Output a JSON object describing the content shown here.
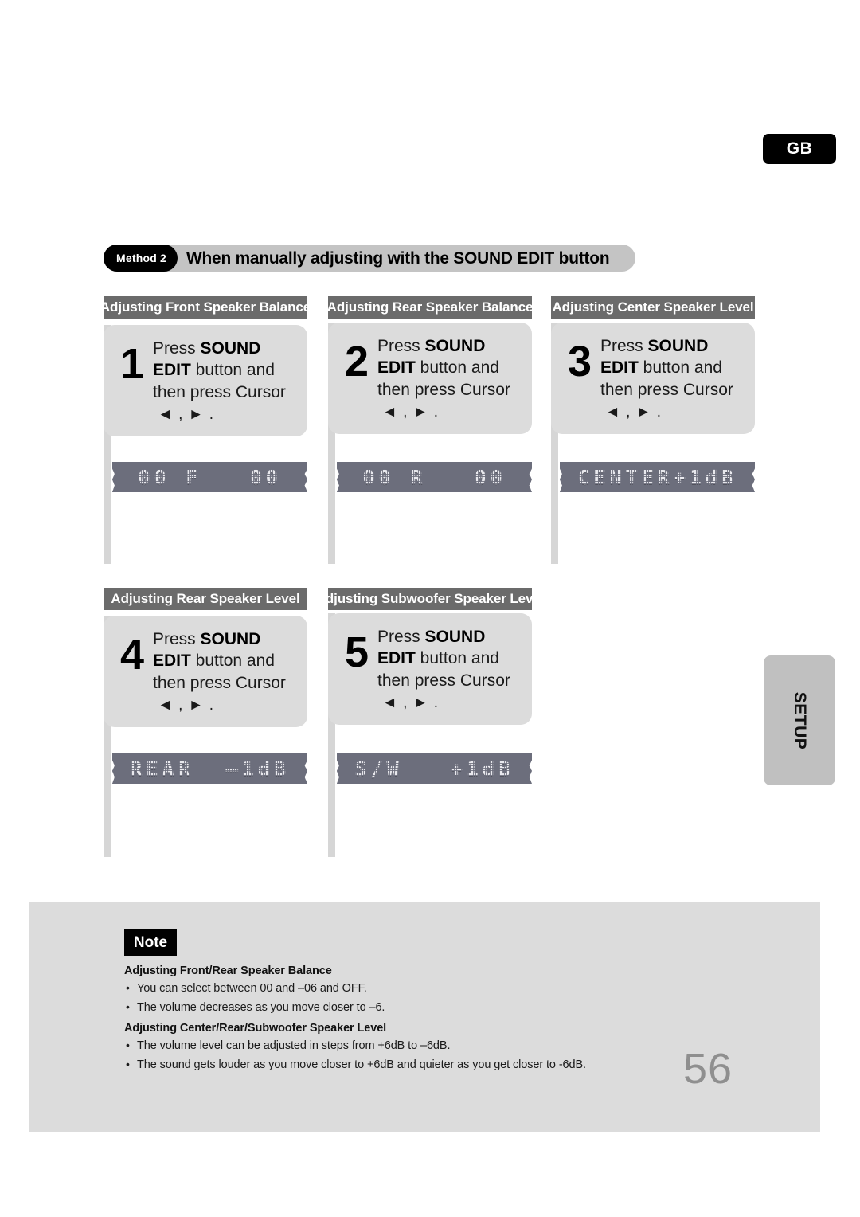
{
  "language_tab": {
    "label": "GB"
  },
  "side_tab": {
    "label": "SETUP"
  },
  "method_banner": {
    "badge": "Method 2",
    "title": "When manually adjusting with the SOUND EDIT button"
  },
  "steps": [
    {
      "header": "Adjusting Front Speaker Balance",
      "number": "1",
      "line1_pre": "Press ",
      "line1_bold": "SOUND",
      "line2_bold": "EDIT",
      "line2_post": " button and",
      "line3": "then press Cursor",
      "cursor": "◄ , ► .",
      "display": "00 F   00"
    },
    {
      "header": "Adjusting Rear Speaker Balance",
      "number": "2",
      "line1_pre": "Press ",
      "line1_bold": "SOUND",
      "line2_bold": "EDIT",
      "line2_post": " button and",
      "line3": "then press Cursor",
      "cursor": "◄ , ► .",
      "display": "00 R   00"
    },
    {
      "header": "Adjusting Center Speaker Level",
      "number": "3",
      "line1_pre": "Press ",
      "line1_bold": "SOUND",
      "line2_bold": "EDIT",
      "line2_post": " button and",
      "line3": "then press Cursor",
      "cursor": "◄ , ► .",
      "display": "CENTER+1dB"
    },
    {
      "header": "Adjusting Rear Speaker Level",
      "number": "4",
      "line1_pre": "Press ",
      "line1_bold": "SOUND",
      "line2_bold": "EDIT",
      "line2_post": " button and",
      "line3": "then press Cursor",
      "cursor": "◄ , ► .",
      "display": "REAR  –1dB"
    },
    {
      "header": "Adjusting Subwoofer Speaker Level",
      "number": "5",
      "line1_pre": "Press ",
      "line1_bold": "SOUND",
      "line2_bold": "EDIT",
      "line2_post": " button and",
      "line3": "then press Cursor",
      "cursor": "◄ , ► .",
      "display": "S/W   +1dB"
    }
  ],
  "note": {
    "badge": "Note",
    "section1_heading": "Adjusting Front/Rear Speaker Balance",
    "section1_bullets": [
      "You can select between 00 and –06 and OFF.",
      "The volume decreases as you move closer to –6."
    ],
    "section2_heading": "Adjusting Center/Rear/Subwoofer Speaker Level",
    "section2_bullets": [
      "The volume level can be adjusted in steps from +6dB to –6dB.",
      "The sound gets louder as you move closer to +6dB and quieter as you get closer to -6dB."
    ]
  },
  "page_number": "56",
  "colors": {
    "header_bar": "#6b6b6b",
    "step_box": "#dcdcdc",
    "lcd_bg": "#6c6e7c",
    "lcd_text": "#e9e9ee",
    "spine": "#d6d6d6",
    "note_bg": "#dcdcdc",
    "badge_black": "#000000",
    "page_number": "#8f8f8f",
    "setup_tab": "#c0c0c0"
  }
}
